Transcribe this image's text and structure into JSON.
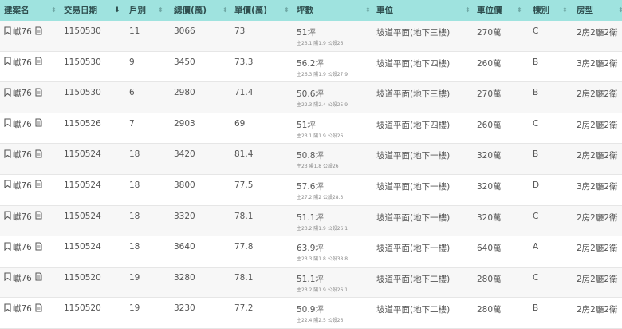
{
  "header": {
    "columns": [
      {
        "key": "name",
        "label": "建案名",
        "sort": "none"
      },
      {
        "key": "date",
        "label": "交易日期",
        "sort": "desc"
      },
      {
        "key": "unit",
        "label": "戶別",
        "sort": "none"
      },
      {
        "key": "total",
        "label": "總價(萬)",
        "sort": "none"
      },
      {
        "key": "unit_price",
        "label": "單價(萬)",
        "sort": "none"
      },
      {
        "key": "area",
        "label": "坪數",
        "sort": "none"
      },
      {
        "key": "parking",
        "label": "車位",
        "sort": "none"
      },
      {
        "key": "parking_price",
        "label": "車位價",
        "sort": "none"
      },
      {
        "key": "building",
        "label": "棟別",
        "sort": "none"
      },
      {
        "key": "layout",
        "label": "房型",
        "sort": "none"
      }
    ]
  },
  "rows": [
    {
      "name": "巘76",
      "date": "1150530",
      "unit": "11",
      "total": "3066",
      "unit_price": "73",
      "area": "51坪",
      "area_detail": "主23.1 陽1.9 公設26",
      "parking": "坡道平面(地下三樓)",
      "parking_price": "270萬",
      "building": "C",
      "layout": "2房2廳2衛"
    },
    {
      "name": "巘76",
      "date": "1150530",
      "unit": "9",
      "total": "3450",
      "unit_price": "73.3",
      "area": "56.2坪",
      "area_detail": "主26.3 陽1.9 公設27.9",
      "parking": "坡道平面(地下四樓)",
      "parking_price": "260萬",
      "building": "B",
      "layout": "3房2廳2衛"
    },
    {
      "name": "巘76",
      "date": "1150530",
      "unit": "6",
      "total": "2980",
      "unit_price": "71.4",
      "area": "50.6坪",
      "area_detail": "主22.3 陽2.4 公設25.9",
      "parking": "坡道平面(地下三樓)",
      "parking_price": "270萬",
      "building": "B",
      "layout": "2房2廳2衛"
    },
    {
      "name": "巘76",
      "date": "1150526",
      "unit": "7",
      "total": "2903",
      "unit_price": "69",
      "area": "51坪",
      "area_detail": "主23.1 陽1.9 公設26",
      "parking": "坡道平面(地下四樓)",
      "parking_price": "260萬",
      "building": "C",
      "layout": "2房2廳2衛"
    },
    {
      "name": "巘76",
      "date": "1150524",
      "unit": "18",
      "total": "3420",
      "unit_price": "81.4",
      "area": "50.8坪",
      "area_detail": "主23 陽1.8 公設26",
      "parking": "坡道平面(地下一樓)",
      "parking_price": "320萬",
      "building": "B",
      "layout": "2房2廳2衛"
    },
    {
      "name": "巘76",
      "date": "1150524",
      "unit": "18",
      "total": "3800",
      "unit_price": "77.5",
      "area": "57.6坪",
      "area_detail": "主27.2 陽2 公設28.3",
      "parking": "坡道平面(地下一樓)",
      "parking_price": "320萬",
      "building": "D",
      "layout": "3房2廳2衛"
    },
    {
      "name": "巘76",
      "date": "1150524",
      "unit": "18",
      "total": "3320",
      "unit_price": "78.1",
      "area": "51.1坪",
      "area_detail": "主23.2 陽1.9 公設26.1",
      "parking": "坡道平面(地下一樓)",
      "parking_price": "320萬",
      "building": "C",
      "layout": "2房2廳2衛"
    },
    {
      "name": "巘76",
      "date": "1150524",
      "unit": "18",
      "total": "3640",
      "unit_price": "77.8",
      "area": "63.9坪",
      "area_detail": "主23.3 陽1.8 公設38.8",
      "parking": "坡道平面(地下一樓)",
      "parking_price": "640萬",
      "building": "A",
      "layout": "2房2廳2衛"
    },
    {
      "name": "巘76",
      "date": "1150520",
      "unit": "19",
      "total": "3280",
      "unit_price": "78.1",
      "area": "51.1坪",
      "area_detail": "主23.2 陽1.9 公設26.1",
      "parking": "坡道平面(地下二樓)",
      "parking_price": "280萬",
      "building": "C",
      "layout": "2房2廳2衛"
    },
    {
      "name": "巘76",
      "date": "1150520",
      "unit": "19",
      "total": "3230",
      "unit_price": "77.2",
      "area": "50.9坪",
      "area_detail": "主22.4 陽2.5 公設26",
      "parking": "坡道平面(地下二樓)",
      "parking_price": "280萬",
      "building": "B",
      "layout": "2房2廳2衛"
    }
  ],
  "icons": {
    "bookmark": "bookmark-icon",
    "document": "document-icon",
    "sort": "sort-icon",
    "sort_desc": "sort-desc-icon"
  },
  "colors": {
    "header_bg": "#9fe3df",
    "header_text": "#2f4f4f",
    "row_alt": "#f7f7f7"
  }
}
